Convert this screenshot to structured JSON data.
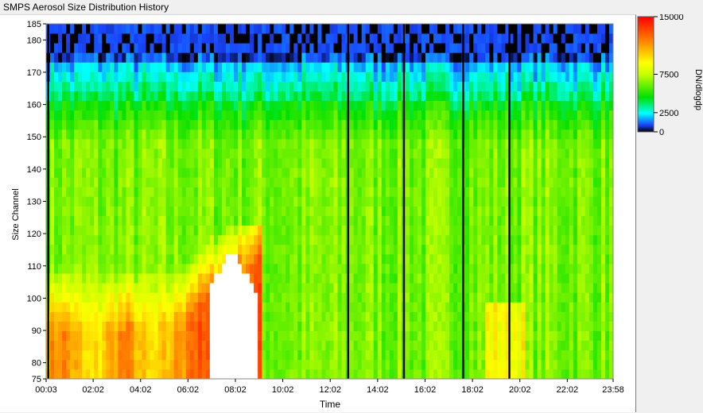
{
  "window": {
    "title": "SMPS Aerosol Size Distribution History"
  },
  "chart_data": {
    "type": "heatmap",
    "title": "SMPS Aerosol Size Distribution History",
    "xlabel": "Time",
    "ylabel": "Size Channel",
    "x_tick_labels": [
      "00:03",
      "02:02",
      "04:02",
      "06:02",
      "08:02",
      "10:02",
      "12:02",
      "14:02",
      "16:02",
      "18:02",
      "20:02",
      "22:02",
      "23:58"
    ],
    "x_tick_values_hours": [
      0.05,
      2.033,
      4.033,
      6.033,
      8.033,
      10.033,
      12.033,
      14.033,
      16.033,
      18.033,
      20.033,
      22.033,
      23.967
    ],
    "xlim_hours": [
      0.05,
      23.967
    ],
    "y_ticks": [
      75,
      80,
      90,
      100,
      110,
      120,
      130,
      140,
      150,
      160,
      170,
      180,
      185
    ],
    "ylim": [
      75,
      185
    ],
    "colorbar": {
      "label": "DN/dlogdp",
      "ticks": [
        0,
        2500,
        7500,
        15000
      ],
      "range": [
        0,
        15000
      ],
      "colors": [
        "#000000",
        "#1a44ff",
        "#00ffff",
        "#00e000",
        "#c8ff00",
        "#ffff00",
        "#ff8800",
        "#ff0000"
      ]
    },
    "gap_lines_hours": [
      0.1,
      12.75,
      15.1,
      17.6,
      19.55
    ],
    "white_saturated_region": {
      "time_hours": [
        6.9,
        8.9
      ],
      "channels": [
        75,
        115
      ]
    }
  }
}
